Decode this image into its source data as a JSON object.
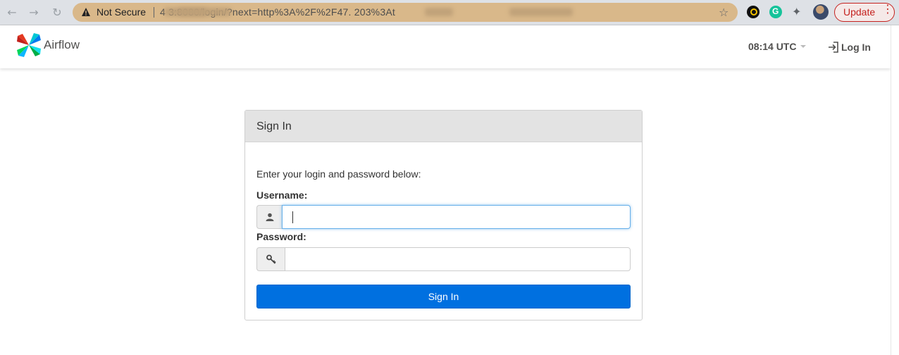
{
  "browser": {
    "security_label": "Not Secure",
    "url_visible": "4            3:8080/login/?next=http%3A%2F%2F47.              203%3At",
    "update_label": "Update",
    "icons": [
      "back-icon",
      "forward-icon",
      "reload-icon",
      "warning-icon",
      "star-icon",
      "extension-icon",
      "grammarly-icon",
      "puzzle-icon",
      "profile-avatar",
      "kebab-icon"
    ]
  },
  "navbar": {
    "brand": "Airflow",
    "clock": "08:14 UTC",
    "login_label": "Log In"
  },
  "signin": {
    "title": "Sign In",
    "intro": "Enter your login and password below:",
    "username_label": "Username:",
    "username_value": "",
    "password_label": "Password:",
    "password_value": "",
    "submit_label": "Sign In"
  },
  "colors": {
    "primary": "#0070e0",
    "focus_border": "#66afe9",
    "omnibox": "#d9b88a",
    "update_red": "#c5221f"
  }
}
